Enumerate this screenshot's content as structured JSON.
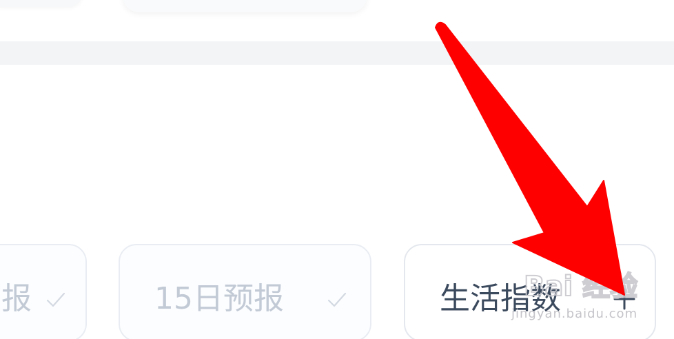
{
  "tabs": [
    {
      "label": "报",
      "state": "selected"
    },
    {
      "label": "15日预报",
      "state": "selected"
    },
    {
      "label": "生活指数",
      "state": "addable"
    }
  ],
  "watermark": {
    "logo_text": "Bai 经验",
    "url_text": "jingyan.baidu.com"
  },
  "colors": {
    "arrow": "#ff0000",
    "card_border": "#e9edf3",
    "dim_text": "#c2cad6",
    "active_text": "#3c4a5e"
  }
}
